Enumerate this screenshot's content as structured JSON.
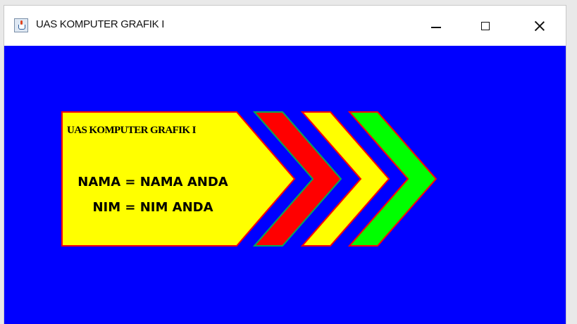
{
  "window": {
    "title": "UAS KOMPUTER GRAFIK I",
    "icon": "java-cup-icon",
    "controls": {
      "minimize": "minimize-icon",
      "maximize": "maximize-icon",
      "close": "close-icon"
    }
  },
  "canvas": {
    "background": "#0000ff",
    "banner": {
      "fill": "#ffff00",
      "outline": "#ff0000",
      "title": "UAS KOMPUTER GRAFIK I",
      "name_line": "NAMA = NAMA ANDA",
      "nim_line": "NIM = NIM ANDA"
    },
    "chevrons": [
      {
        "fill": "#ff0000",
        "outline": "#00aa55"
      },
      {
        "fill": "#ffff00",
        "outline": "#ff0000"
      },
      {
        "fill": "#00ff00",
        "outline": "#ff0000"
      }
    ]
  }
}
